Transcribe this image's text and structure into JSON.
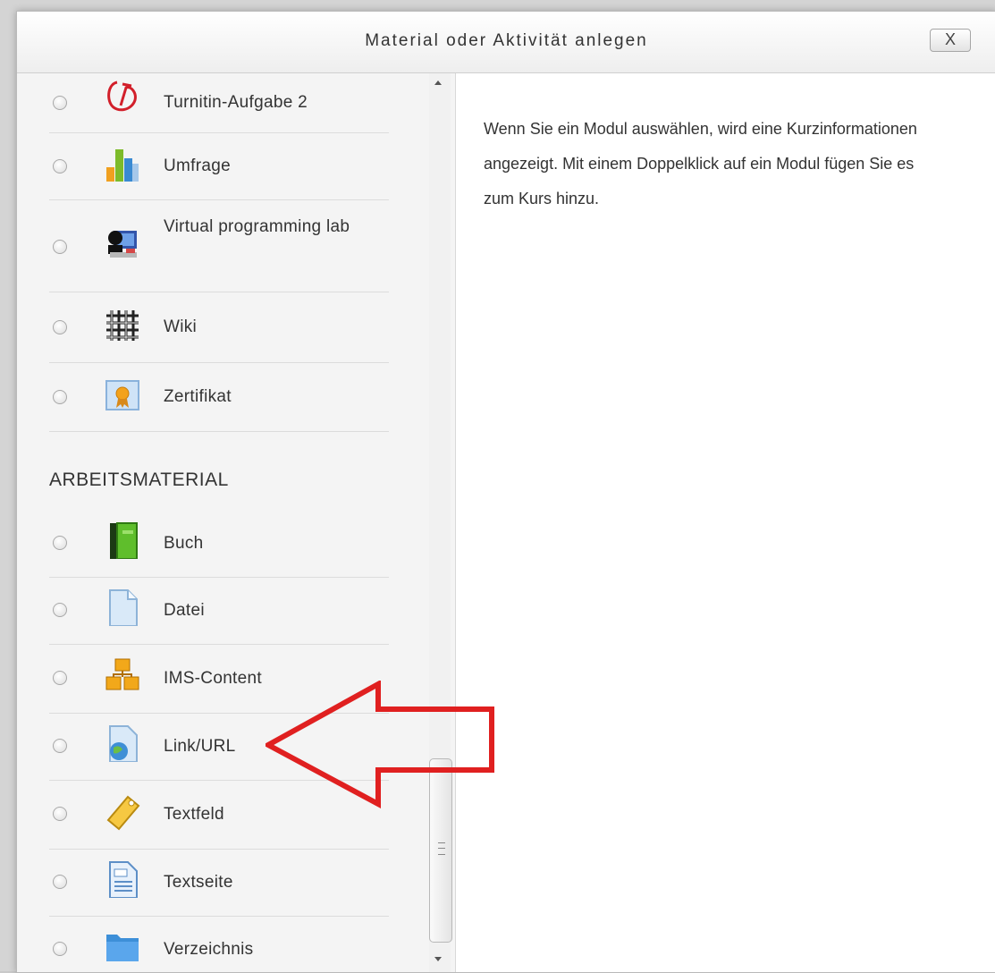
{
  "dialog": {
    "title": "Material oder Aktivität anlegen",
    "close_label": "X"
  },
  "info_text": "Wenn Sie ein Modul auswählen, wird eine Kurzinformationen angezeigt. Mit einem Doppelklick auf ein Modul fügen Sie es zum Kurs hinzu.",
  "activities": [
    {
      "label": "Turnitin-Aufgabe 2",
      "icon": "turnitin-icon"
    },
    {
      "label": "Umfrage",
      "icon": "survey-chart-icon"
    },
    {
      "label": "Virtual programming lab",
      "icon": "vpl-icon"
    },
    {
      "label": "Wiki",
      "icon": "wiki-icon"
    },
    {
      "label": "Zertifikat",
      "icon": "certificate-icon"
    }
  ],
  "section_heading": "ARBEITSMATERIAL",
  "resources": [
    {
      "label": "Buch",
      "icon": "book-icon"
    },
    {
      "label": "Datei",
      "icon": "file-icon"
    },
    {
      "label": "IMS-Content",
      "icon": "ims-package-icon"
    },
    {
      "label": "Link/URL",
      "icon": "url-globe-icon"
    },
    {
      "label": "Textfeld",
      "icon": "label-tag-icon"
    },
    {
      "label": "Textseite",
      "icon": "page-icon"
    },
    {
      "label": "Verzeichnis",
      "icon": "folder-icon"
    }
  ],
  "colors": {
    "accent_arrow": "#e02020",
    "panel_bg": "#f4f4f4"
  }
}
